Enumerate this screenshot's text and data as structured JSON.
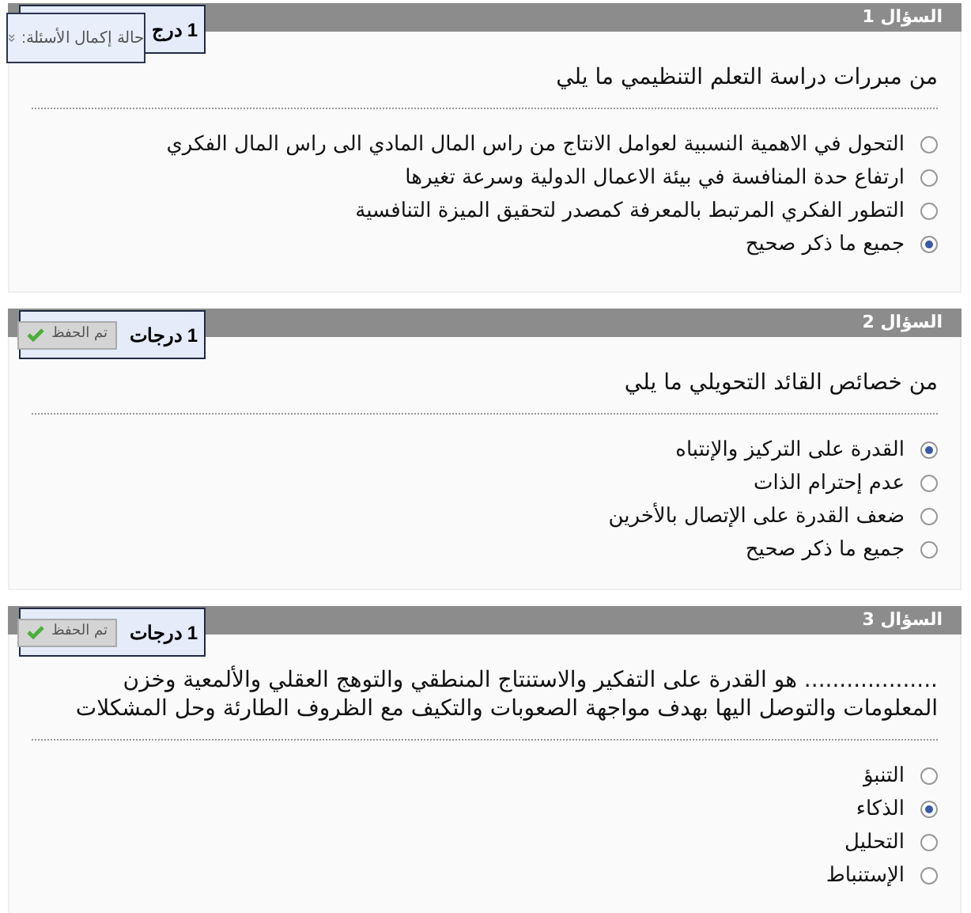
{
  "status_panel": {
    "label": "حالة إكمال الأسئلة:"
  },
  "questions": [
    {
      "title": "السؤال 1",
      "points": "1 درج",
      "text": "من مبررات دراسة التعلم التنظيمي ما يلي",
      "options": [
        {
          "label": "التحول في الاهمية النسبية لعوامل الانتاج من راس المال المادي الى راس المال الفكري",
          "selected": false
        },
        {
          "label": "ارتفاع حدة المنافسة في بيئة الاعمال الدولية وسرعة تغيرها",
          "selected": false
        },
        {
          "label": "التطور الفكري المرتبط بالمعرفة كمصدر لتحقيق الميزة التنافسية",
          "selected": false
        },
        {
          "label": "جميع ما ذكر صحيح",
          "selected": true
        }
      ]
    },
    {
      "title": "السؤال 2",
      "points": "1 درجات",
      "saved_label": "تم الحفظ",
      "text": "من خصائص القائد التحويلي ما يلي",
      "options": [
        {
          "label": "القدرة على التركيز والإنتباه",
          "selected": true
        },
        {
          "label": "عدم إحترام الذات",
          "selected": false
        },
        {
          "label": "ضعف القدرة على الإتصال بالأخرين",
          "selected": false
        },
        {
          "label": "جميع ما ذكر صحيح",
          "selected": false
        }
      ]
    },
    {
      "title": "السؤال 3",
      "points": "1 درجات",
      "saved_label": "تم الحفظ",
      "text": "................... هو القدرة على التفكير والاستنتاج المنطقي والتوهج العقلي والألمعية وخزن المعلومات والتوصل اليها بهدف مواجهة الصعوبات والتكيف مع الظروف الطارئة وحل المشكلات",
      "options": [
        {
          "label": "التنبؤ",
          "selected": false
        },
        {
          "label": "الذكاء",
          "selected": true
        },
        {
          "label": "التحليل",
          "selected": false
        },
        {
          "label": "الإستنباط",
          "selected": false
        }
      ]
    }
  ]
}
